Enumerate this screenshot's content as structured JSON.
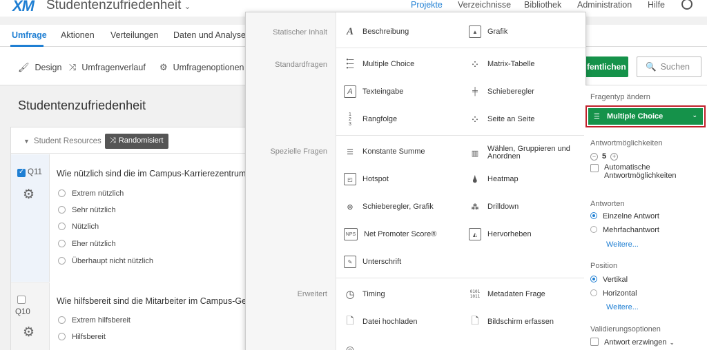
{
  "header": {
    "logo": "XM",
    "title": "Studentenzufriedenheit",
    "nav": [
      "Projekte",
      "Verzeichnisse",
      "Bibliothek",
      "Administration",
      "Hilfe"
    ]
  },
  "tabs": [
    "Umfrage",
    "Aktionen",
    "Verteilungen",
    "Daten und Analyse"
  ],
  "toolbar": {
    "design": "Design",
    "history": "Umfragenverlauf",
    "options": "Umfragenoptionen",
    "publish": "fentlichen",
    "search": "Suchen"
  },
  "survey": {
    "title": "Studentenzufriedenheit",
    "block_name": "Student Resources",
    "randomized_badge": "Randomisiert",
    "questions": [
      {
        "num": "Q11",
        "text": "Wie nützlich sind die im Campus-Karrierezentrum",
        "choices": [
          "Extrem nützlich",
          "Sehr nützlich",
          "Nützlich",
          "Eher nützlich",
          "Überhaupt nicht nützlich"
        ]
      },
      {
        "num": "Q10",
        "text": "Wie hilfsbereit sind die Mitarbeiter im Campus-Ge",
        "choices": [
          "Extrem hilfsbereit",
          "Hilfsbereit"
        ]
      }
    ]
  },
  "qtype_menu": {
    "categories": [
      "Statischer Inhalt",
      "Standardfragen",
      "Spezielle Fragen",
      "Erweitert"
    ],
    "items": [
      {
        "label": "Beschreibung",
        "icon": "text-a-icon"
      },
      {
        "label": "Grafik",
        "icon": "image-icon"
      },
      {
        "label": "Multiple Choice",
        "icon": "multiple-choice-icon"
      },
      {
        "label": "Matrix-Tabelle",
        "icon": "matrix-icon"
      },
      {
        "label": "Texteingabe",
        "icon": "text-entry-icon"
      },
      {
        "label": "Schieberegler",
        "icon": "slider-icon"
      },
      {
        "label": "Rangfolge",
        "icon": "rank-icon"
      },
      {
        "label": "Seite an Seite",
        "icon": "side-by-side-icon"
      },
      {
        "label": "Konstante Summe",
        "icon": "constant-sum-icon"
      },
      {
        "label": "Wählen, Gruppieren und Anordnen",
        "icon": "pick-group-rank-icon"
      },
      {
        "label": "Hotspot",
        "icon": "hotspot-icon"
      },
      {
        "label": "Heatmap",
        "icon": "heatmap-icon"
      },
      {
        "label": "Schieberegler, Grafik",
        "icon": "graphic-slider-icon"
      },
      {
        "label": "Drilldown",
        "icon": "drilldown-icon"
      },
      {
        "label": "Net Promoter Score®",
        "icon": "nps-icon"
      },
      {
        "label": "Hervorheben",
        "icon": "highlight-icon"
      },
      {
        "label": "Unterschrift",
        "icon": "signature-icon"
      },
      {
        "label": "Timing",
        "icon": "timer-icon"
      },
      {
        "label": "Metadaten Frage",
        "icon": "metadata-icon"
      },
      {
        "label": "Datei hochladen",
        "icon": "file-icon"
      },
      {
        "label": "Bildschirm erfassen",
        "icon": "screen-capture-icon"
      }
    ]
  },
  "right_panel": {
    "qtype_label": "Fragentyp ändern",
    "qtype_value": "Multiple Choice",
    "answer_options_label": "Antwortmöglichkeiten",
    "answer_count": "5",
    "auto_options": "Automatische Antwortmöglichkeiten",
    "answers_label": "Antworten",
    "single": "Einzelne Antwort",
    "multiple": "Mehrfachantwort",
    "more": "Weitere...",
    "position_label": "Position",
    "vertical": "Vertikal",
    "horizontal": "Horizontal",
    "more2": "Weitere...",
    "validation_label": "Validierungsoptionen",
    "force_response": "Antwort erzwingen"
  },
  "colors": {
    "accent": "#1f7fd3",
    "green": "#15924a",
    "highlight_border": "#c0202b"
  }
}
